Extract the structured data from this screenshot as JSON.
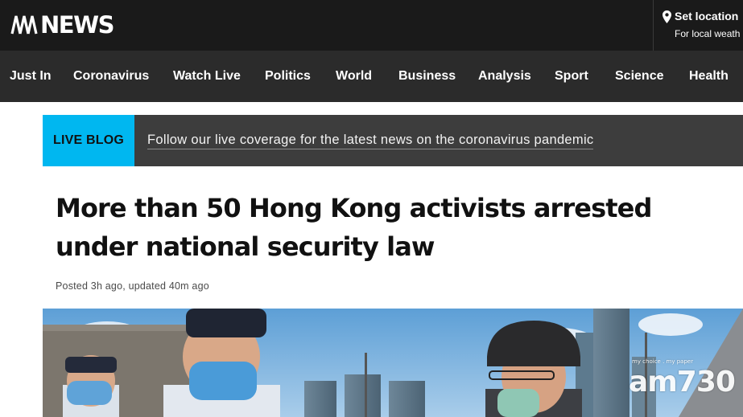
{
  "header": {
    "brand": "NEWS",
    "location_title": "Set location",
    "location_sub": "For local weath"
  },
  "nav": {
    "items": [
      {
        "label": "Just In"
      },
      {
        "label": "Coronavirus"
      },
      {
        "label": "Watch Live"
      },
      {
        "label": "Politics"
      },
      {
        "label": "World"
      },
      {
        "label": "Business"
      },
      {
        "label": "Analysis"
      },
      {
        "label": "Sport"
      },
      {
        "label": "Science"
      },
      {
        "label": "Health"
      }
    ]
  },
  "live_blog": {
    "badge": "LIVE BLOG",
    "link_text": "Follow our live coverage for the latest news on the coronavirus pandemic"
  },
  "article": {
    "headline": "More than 50 Hong Kong activists arrested under national security law",
    "byline": "Posted 3h ago, updated 40m ago",
    "photo_watermark": "am730",
    "photo_watermark_small": "my choice . my paper"
  },
  "colors": {
    "header_bg": "#1a1a1a",
    "nav_bg": "#2b2b2b",
    "live_badge": "#00b7f0",
    "live_bar": "#3d3d3d"
  }
}
